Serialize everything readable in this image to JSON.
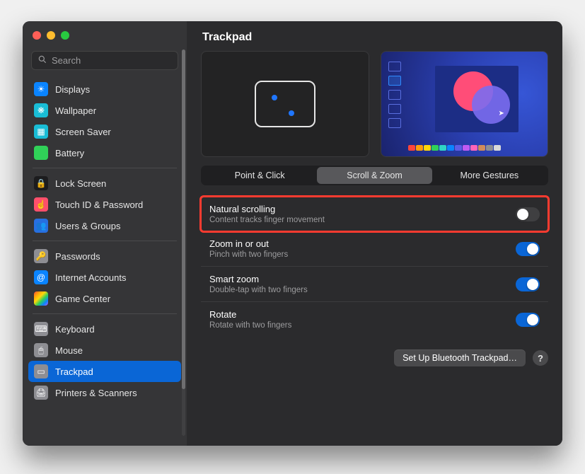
{
  "title": "Trackpad",
  "search": {
    "placeholder": "Search"
  },
  "sidebar": {
    "groups": [
      [
        {
          "label": "Displays",
          "bg": "#0a84ff",
          "glyph": "☀"
        },
        {
          "label": "Wallpaper",
          "bg": "#19bdd6",
          "glyph": "❋"
        },
        {
          "label": "Screen Saver",
          "bg": "#19bdd6",
          "glyph": "▦"
        },
        {
          "label": "Battery",
          "bg": "#30d158",
          "glyph": ""
        }
      ],
      [
        {
          "label": "Lock Screen",
          "bg": "#1c1c1e",
          "glyph": "🔒"
        },
        {
          "label": "Touch ID & Password",
          "bg": "#ff4f6b",
          "glyph": "☝"
        },
        {
          "label": "Users & Groups",
          "bg": "#276fe0",
          "glyph": "👥"
        }
      ],
      [
        {
          "label": "Passwords",
          "bg": "#8e8e93",
          "glyph": "🔑"
        },
        {
          "label": "Internet Accounts",
          "bg": "#0a84ff",
          "glyph": "@"
        },
        {
          "label": "Game Center",
          "bg": "linear-gradient(135deg,#ff453a,#ff9f0a,#ffd60a,#30d158,#0a84ff,#bf5af2)",
          "glyph": ""
        }
      ],
      [
        {
          "label": "Keyboard",
          "bg": "#8e8e93",
          "glyph": "⌨"
        },
        {
          "label": "Mouse",
          "bg": "#8e8e93",
          "glyph": "🖱"
        },
        {
          "label": "Trackpad",
          "bg": "#8e8e93",
          "glyph": "▭",
          "selected": true
        },
        {
          "label": "Printers & Scanners",
          "bg": "#8e8e93",
          "glyph": "🖨"
        }
      ]
    ]
  },
  "tabs": [
    {
      "label": "Point & Click",
      "active": false
    },
    {
      "label": "Scroll & Zoom",
      "active": true
    },
    {
      "label": "More Gestures",
      "active": false
    }
  ],
  "settings": [
    {
      "title": "Natural scrolling",
      "desc": "Content tracks finger movement",
      "on": false,
      "highlight": true
    },
    {
      "title": "Zoom in or out",
      "desc": "Pinch with two fingers",
      "on": true
    },
    {
      "title": "Smart zoom",
      "desc": "Double-tap with two fingers",
      "on": true
    },
    {
      "title": "Rotate",
      "desc": "Rotate with two fingers",
      "on": true
    }
  ],
  "footer": {
    "setup_button": "Set Up Bluetooth Trackpad…",
    "help": "?"
  },
  "colorStrip": [
    "#ff453a",
    "#ff9f0a",
    "#ffd60a",
    "#30d158",
    "#2fd4c5",
    "#0a84ff",
    "#5e5ce6",
    "#bf5af2",
    "#ff64b9",
    "#d08b5a",
    "#8e8e93",
    "#d9d9d9"
  ]
}
